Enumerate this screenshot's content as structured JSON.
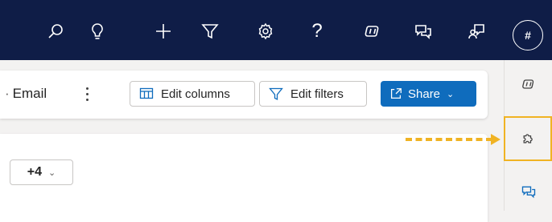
{
  "topbar": {
    "icons": [
      "search-icon",
      "lightbulb-icon",
      "plus-icon",
      "filter-icon",
      "settings-icon",
      "help-icon",
      "copilot-icon",
      "chat-icon",
      "feedback-icon"
    ],
    "avatar_text": "#",
    "help_glyph": "?"
  },
  "toolbar": {
    "email_label": "Email",
    "edit_columns_label": "Edit columns",
    "edit_filters_label": "Edit filters",
    "share_label": "Share"
  },
  "content": {
    "plus_button_label": "+4"
  },
  "right_panel": {
    "icons": [
      "copilot-icon",
      "puzzle-icon",
      "chat-icon"
    ]
  },
  "colors": {
    "topbar": "#0f1d47",
    "primary": "#0f6cbd",
    "highlight": "#f0b323"
  }
}
